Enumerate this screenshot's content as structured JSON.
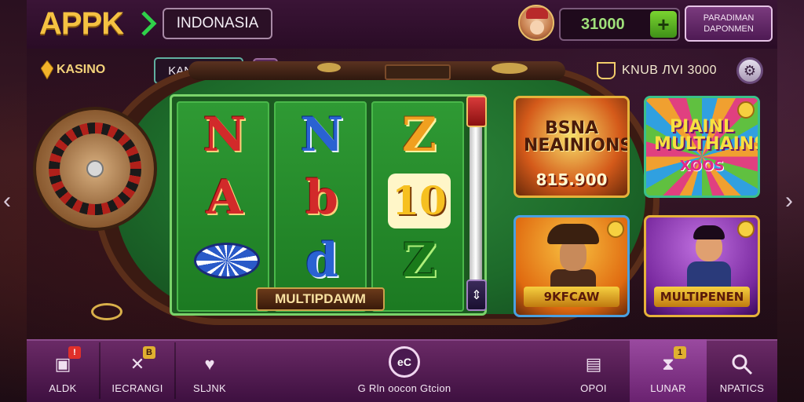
{
  "header": {
    "logo_text": "APPK",
    "country_label": "INDONASIA",
    "balance": "31000",
    "balance_add": "+",
    "promo_button": "PARADIMAN DAPONMEN"
  },
  "subheader": {
    "section_label": "KASINO",
    "search_value": "KANDNCIA",
    "add_button": "+",
    "bonus_text": "KNUB ЛVI 3000"
  },
  "slot": {
    "reels": [
      [
        "N",
        "A",
        ""
      ],
      [
        "N",
        "b",
        "d"
      ],
      [
        "Z",
        "10",
        "Z"
      ]
    ],
    "label": "MULTIPDAWM"
  },
  "games": [
    {
      "title": "BSNA NEAINIONS",
      "amount": "815.900"
    },
    {
      "title": "PIAINL MULTHAINS",
      "subtitle": "XOOS"
    },
    {
      "title": "9KFCAW"
    },
    {
      "title": "MULTIPENEN"
    }
  ],
  "bottom_nav": [
    {
      "label": "ALDK",
      "badge": "!"
    },
    {
      "label": "IECRANGI",
      "badge": "B"
    },
    {
      "label": "SLJNK"
    },
    {
      "label": "G Rln oocon Gtcion",
      "icon_text": "eC"
    },
    {
      "label": "OPOI"
    },
    {
      "label": "LUNAR",
      "badge": "1",
      "active": true
    },
    {
      "label": "NPATICS"
    }
  ],
  "colors": {
    "logo": "#f5c242",
    "balance_text": "#9fe07a",
    "felt": "#1d6a2a",
    "nav_bg": "#6a2a66"
  }
}
